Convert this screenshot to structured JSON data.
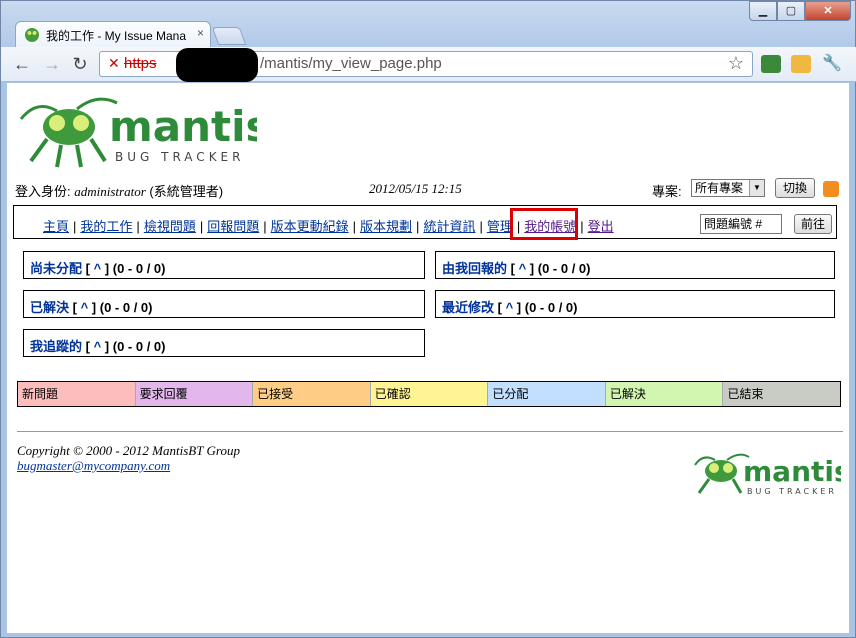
{
  "browser": {
    "tab_title": "我的工作 - My Issue Mana",
    "tab_close": "×",
    "url_scheme": "https",
    "url_path": "/mantis/my_view_page.php"
  },
  "logo": {
    "word": "mantis",
    "sub": "BUG TRACKER"
  },
  "header": {
    "login_label": "登入身份: ",
    "username": "administrator",
    "role": " (系統管理者)",
    "datetime": "2012/05/15 12:15",
    "project_label": "專案:",
    "project_value": "所有專案",
    "switch_button": "切換"
  },
  "menu": {
    "items": [
      "主頁",
      "我的工作",
      "檢視問題",
      "回報問題",
      "版本更動紀錄",
      "版本規劃",
      "統計資訊",
      "管理",
      "我的帳號",
      "登出"
    ],
    "issue_search_placeholder": "問題編號 #",
    "go_button": "前往"
  },
  "boxes": {
    "unassigned": {
      "title": "尚未分配",
      "link": "^",
      "count": "(0 - 0 / 0)"
    },
    "reported_by_me": {
      "title": "由我回報的",
      "link": "^",
      "count": "(0 - 0 / 0)"
    },
    "resolved": {
      "title": "已解決",
      "link": "^",
      "count": "(0 - 0 / 0)"
    },
    "recently_modified": {
      "title": "最近修改",
      "link": "^",
      "count": "(0 - 0 / 0)"
    },
    "monitored": {
      "title": "我追蹤的",
      "link": "^",
      "count": "(0 - 0 / 0)"
    }
  },
  "legend": [
    {
      "label": "新問題",
      "color": "#fcbdbd"
    },
    {
      "label": "要求回覆",
      "color": "#e3b7eb"
    },
    {
      "label": "已接受",
      "color": "#ffcd85"
    },
    {
      "label": "已確認",
      "color": "#fff494"
    },
    {
      "label": "已分配",
      "color": "#c2dfff"
    },
    {
      "label": "已解決",
      "color": "#d2f5b0"
    },
    {
      "label": "已結束",
      "color": "#c9ccc4"
    }
  ],
  "footer": {
    "copyright": "Copyright © 2000 - 2012 MantisBT Group",
    "email": "bugmaster@mycompany.com"
  },
  "colors": {
    "link": "#003399",
    "highlight": "#dd0000",
    "logo_green": "#2e8b3a"
  }
}
